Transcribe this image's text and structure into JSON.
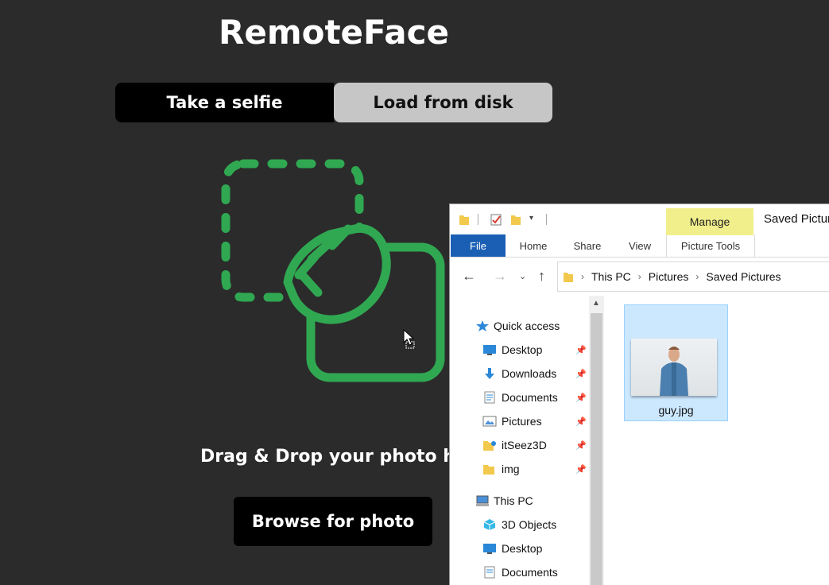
{
  "app": {
    "title": "RemoteFace",
    "tabs": [
      {
        "label": "Take a selfie",
        "active": true
      },
      {
        "label": "Load from disk",
        "active": false
      }
    ],
    "drop_text": "Drag & Drop your photo he",
    "browse_label": "Browse for photo",
    "accent_color": "#30a852"
  },
  "explorer": {
    "manage_label": "Manage",
    "window_title": "Saved Pictur",
    "ribbon_tabs": [
      "File",
      "Home",
      "Share",
      "View",
      "Picture Tools"
    ],
    "breadcrumb": [
      "This PC",
      "Pictures",
      "Saved Pictures"
    ],
    "nav": {
      "quick_access": "Quick access",
      "quick_items": [
        {
          "label": "Desktop",
          "icon": "desktop-icon"
        },
        {
          "label": "Downloads",
          "icon": "download-icon"
        },
        {
          "label": "Documents",
          "icon": "documents-icon"
        },
        {
          "label": "Pictures",
          "icon": "pictures-icon"
        },
        {
          "label": "itSeez3D",
          "icon": "folder-icon"
        },
        {
          "label": "img",
          "icon": "folder-icon"
        }
      ],
      "this_pc": "This PC",
      "pc_items": [
        {
          "label": "3D Objects",
          "icon": "3d-objects-icon"
        },
        {
          "label": "Desktop",
          "icon": "desktop-icon"
        },
        {
          "label": "Documents",
          "icon": "documents-icon"
        }
      ]
    },
    "files": [
      {
        "name": "guy.jpg",
        "selected": true
      }
    ]
  }
}
